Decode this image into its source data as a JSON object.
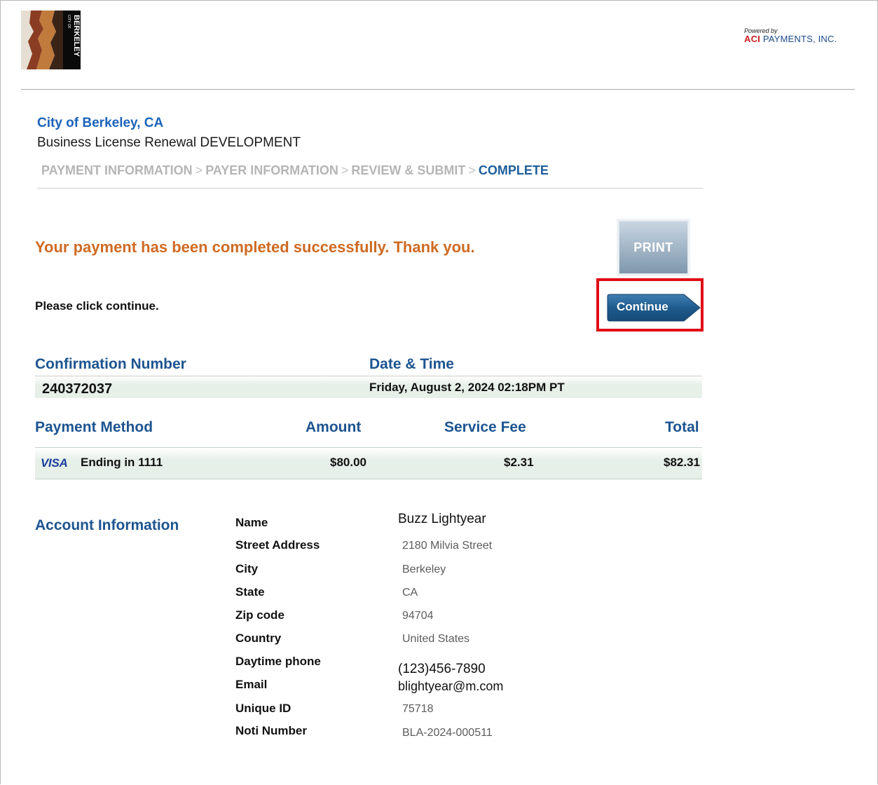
{
  "header": {
    "logo_text": "CITY OF BERKELEY",
    "powered_by": "Powered by",
    "vendor_brand": "ACI",
    "vendor_name": "PAYMENTS, INC."
  },
  "org": {
    "name": "City of Berkeley, CA",
    "service": "Business License Renewal DEVELOPMENT"
  },
  "steps": [
    {
      "label": "PAYMENT INFORMATION"
    },
    {
      "label": "PAYER INFORMATION"
    },
    {
      "label": "REVIEW & SUBMIT"
    },
    {
      "label": "COMPLETE"
    }
  ],
  "step_separator": ">",
  "status": {
    "message": "Your payment has been completed successfully. Thank you.",
    "instruction": "Please click continue."
  },
  "buttons": {
    "print": "PRINT",
    "continue": "Continue"
  },
  "confirmation": {
    "number_label": "Confirmation Number",
    "number": "240372037",
    "datetime_label": "Date & Time",
    "datetime": "Friday, August 2, 2024 02:18PM PT"
  },
  "payment": {
    "method_label": "Payment Method",
    "amount_label": "Amount",
    "fee_label": "Service Fee",
    "total_label": "Total",
    "card_brand": "VISA",
    "card_desc": "Ending in 1111",
    "amount": "$80.00",
    "fee": "$2.31",
    "total": "$82.31"
  },
  "account": {
    "heading": "Account Information",
    "fields": [
      {
        "label": "Name",
        "value": "Buzz Lightyear"
      },
      {
        "label": "Street Address",
        "value": "2180 Milvia Street"
      },
      {
        "label": "City",
        "value": "Berkeley"
      },
      {
        "label": "State",
        "value": "CA"
      },
      {
        "label": "Zip code",
        "value": "94704"
      },
      {
        "label": "Country",
        "value": "United States"
      },
      {
        "label": "Daytime phone",
        "value": "(123)456-7890"
      },
      {
        "label": "Email",
        "value": "blightyear@m.com"
      },
      {
        "label": "Unique ID",
        "value": "75718"
      },
      {
        "label": "Noti Number",
        "value": "BLA-2024-000511"
      }
    ]
  },
  "colors": {
    "link_blue": "#1b63b8",
    "heading_blue": "#1d5490",
    "success_orange": "#cf6a22",
    "highlight_red": "#e10d17",
    "button_blue": "#1f5b8e"
  }
}
